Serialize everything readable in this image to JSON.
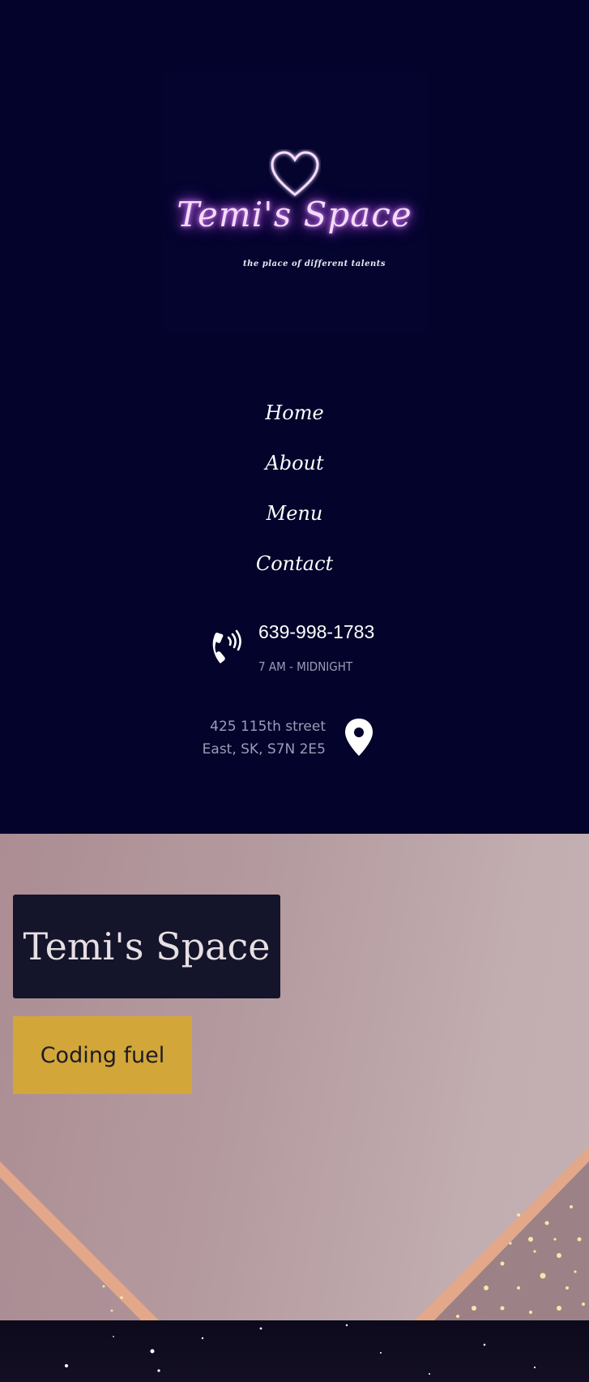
{
  "logo": {
    "title": "Temi's Space",
    "tagline": "the place of different talents",
    "heart_icon": "heart-outline-icon"
  },
  "nav": {
    "items": [
      {
        "label": "Home"
      },
      {
        "label": "About"
      },
      {
        "label": "Menu"
      },
      {
        "label": "Contact"
      }
    ]
  },
  "contact": {
    "phone_icon": "phone-icon",
    "phone": "639-998-1783",
    "hours": "7 AM - MIDNIGHT",
    "address_line1": "425 115th street",
    "address_line2": "East, SK, S7N 2E5",
    "pin_icon": "map-pin-icon"
  },
  "hero": {
    "title": "Temi's Space",
    "cta_label": "Coding fuel"
  },
  "colors": {
    "header_bg": "#03032b",
    "neon_pink": "#d57cff",
    "cta_gold": "#d3a63a",
    "title_box": "#14142a",
    "rose_gold": "#e6a98a"
  }
}
